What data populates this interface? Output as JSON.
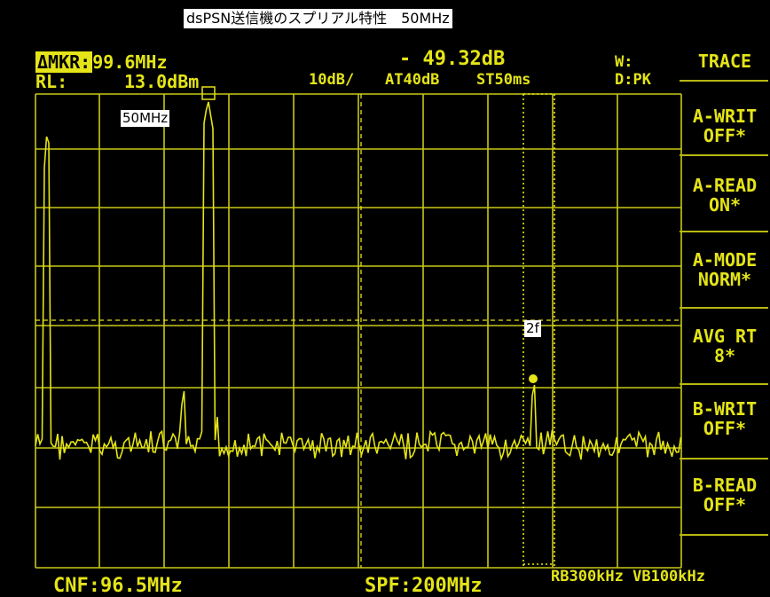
{
  "title": "dsPSN送信機のスプリアル特性　50MHz",
  "header": {
    "marker_badge": "ΔMKR:",
    "marker_freq": "99.6MHz",
    "marker_level": "- 49.32dB",
    "width_label": "W:",
    "ref_label": "RL:",
    "ref_value": "13.0dBm",
    "scale": "10dB/",
    "attenuation": "AT40dB",
    "sweep_time": "ST50ms",
    "detector": "D:PK"
  },
  "annotations": {
    "carrier_label": "50MHz",
    "harmonic_label": "2f"
  },
  "footer": {
    "center_freq": "CNF:96.5MHz",
    "span": "SPF:200MHz",
    "bandwidth": "RB300kHz VB100kHz"
  },
  "softkeys": {
    "title": "TRACE",
    "items": [
      {
        "line1": "A-WRIT",
        "line2": "OFF*"
      },
      {
        "line1": "A-READ",
        "line2": "ON*"
      },
      {
        "line1": "A-MODE",
        "line2": "NORM*"
      },
      {
        "line1": "AVG RT",
        "line2": "8*"
      },
      {
        "line1": "B-WRIT",
        "line2": "OFF*"
      },
      {
        "line1": "B-READ",
        "line2": "OFF*"
      }
    ]
  },
  "colors": {
    "trace": "#e4e418",
    "grid": "#c8c818",
    "background": "#000000"
  }
}
